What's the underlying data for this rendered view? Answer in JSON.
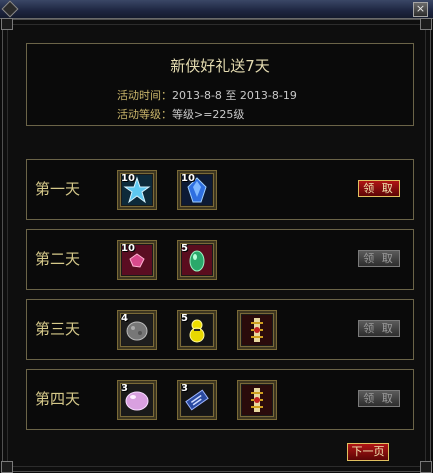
{
  "window": {
    "close_glyph": "×"
  },
  "header": {
    "title": "新侠好礼送7天",
    "time_label": "活动时间：",
    "time_value": "2013-8-8 至 2013-8-19",
    "level_label": "活动等级：",
    "level_value": "等级>=225级"
  },
  "days": [
    {
      "label": "第一天",
      "button": "领 取",
      "button_state": "active",
      "items": [
        {
          "icon": "blue-star-gem-icon",
          "qty": "10"
        },
        {
          "icon": "blue-crystal-icon",
          "qty": "10"
        }
      ]
    },
    {
      "label": "第二天",
      "button": "领 取",
      "button_state": "disabled",
      "items": [
        {
          "icon": "pink-gem-icon",
          "qty": "10"
        },
        {
          "icon": "green-jade-icon",
          "qty": "5"
        }
      ]
    },
    {
      "label": "第三天",
      "button": "领 取",
      "button_state": "disabled",
      "items": [
        {
          "icon": "gray-ore-icon",
          "qty": "4"
        },
        {
          "icon": "yellow-gourd-icon",
          "qty": "5"
        },
        {
          "icon": "golden-talisman-icon",
          "qty": ""
        }
      ]
    },
    {
      "label": "第四天",
      "button": "领 取",
      "button_state": "disabled",
      "items": [
        {
          "icon": "pink-pearl-icon",
          "qty": "3"
        },
        {
          "icon": "blue-scroll-icon",
          "qty": "3"
        },
        {
          "icon": "golden-talisman-icon",
          "qty": ""
        }
      ]
    }
  ],
  "footer": {
    "next_page": "下一页"
  },
  "colors": {
    "accent_gold": "#c8b46a",
    "active_button": "#b01515",
    "disabled_button": "#5a5a5a"
  }
}
